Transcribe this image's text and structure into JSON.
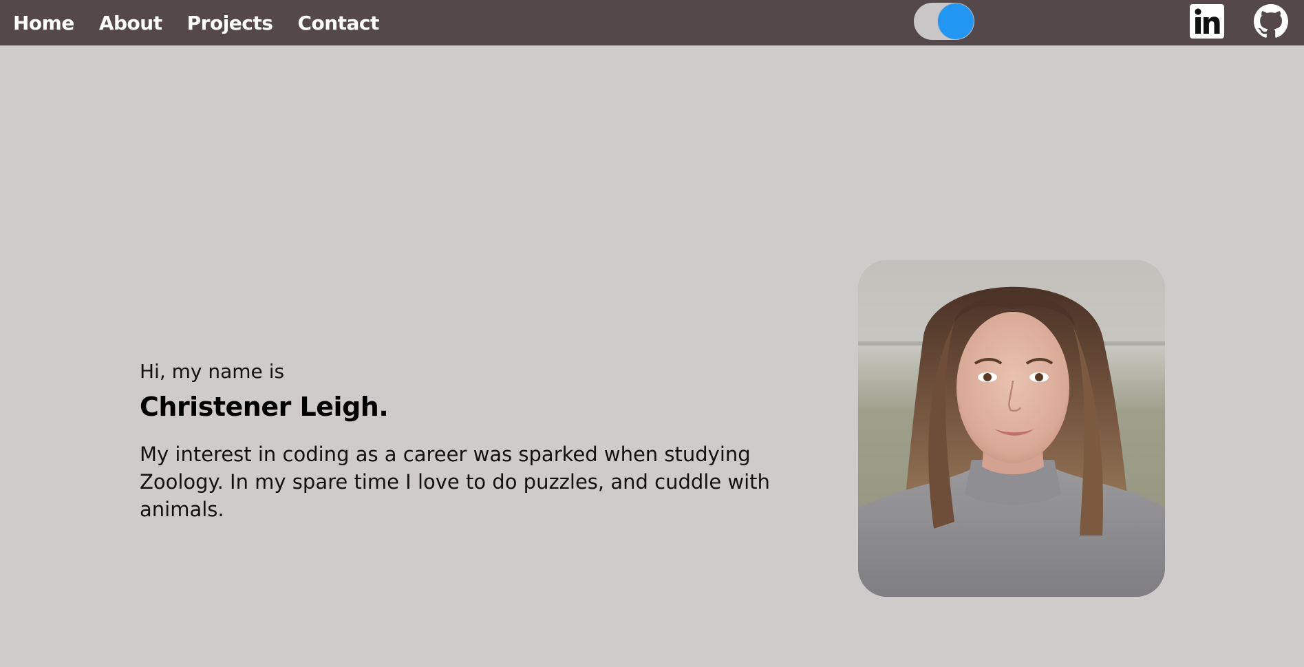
{
  "nav": {
    "links": [
      "Home",
      "About",
      "Projects",
      "Contact"
    ]
  },
  "theme_toggle": {
    "state": "on",
    "knob_color": "#2196f3"
  },
  "social": {
    "linkedin_icon": "linkedin-icon",
    "github_icon": "github-icon"
  },
  "hero": {
    "greeting": "Hi, my name is",
    "name": "Christener Leigh.",
    "bio": "My interest in coding as a career was sparked when studying Zoology. In my spare time I love to do puzzles, and cuddle with animals."
  },
  "colors": {
    "navbar": "#54484a",
    "background": "#cfcbca",
    "accent": "#2196f3"
  }
}
